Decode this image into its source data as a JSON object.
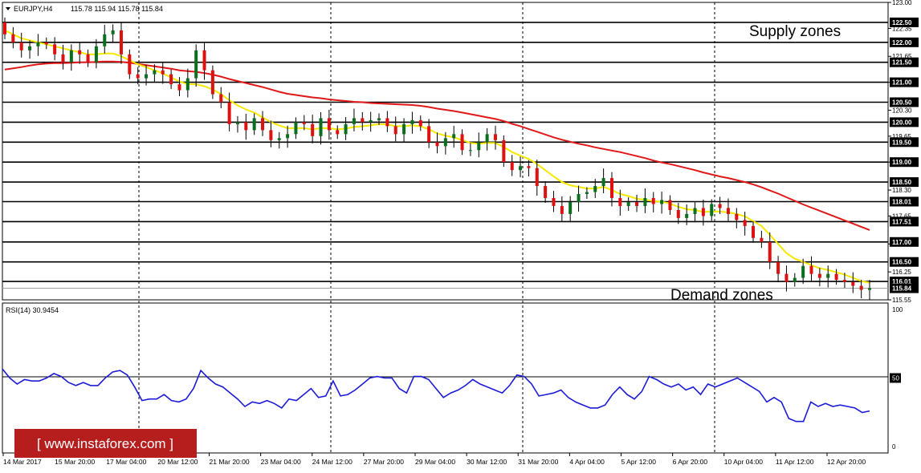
{
  "header": {
    "symbol": "EURJPY,H4",
    "ohlc": "115.78 115.94 115.78 115.84"
  },
  "annotations": {
    "supply": "Supply zones",
    "demand": "Demand zones"
  },
  "watermark": "[ www.instaforex.com ]",
  "rsi": {
    "label": "RSI(14) 30.9454",
    "ticks": [
      "100",
      "50",
      "0"
    ],
    "values": [
      56,
      50,
      46,
      49,
      48,
      48,
      50,
      53,
      51,
      47,
      45,
      47,
      45,
      45,
      50,
      54,
      55,
      52,
      44,
      35,
      36,
      36,
      39,
      35,
      34,
      36,
      43,
      55,
      50,
      46,
      44,
      40,
      36,
      31,
      34,
      33,
      35,
      33,
      30,
      36,
      35,
      39,
      43,
      37,
      38,
      48,
      38,
      39,
      42,
      46,
      50,
      51,
      50,
      50,
      43,
      40,
      51,
      51,
      49,
      43,
      37,
      40,
      42,
      45,
      49,
      46,
      44,
      42,
      40,
      45,
      52,
      51,
      46,
      38,
      39,
      40,
      42,
      37,
      34,
      32,
      30,
      30,
      32,
      39,
      44,
      39,
      36,
      41,
      51,
      49,
      46,
      44,
      46,
      42,
      44,
      39,
      46,
      44,
      46,
      48,
      50,
      47,
      44,
      41,
      34,
      37,
      34,
      23,
      21,
      21,
      34,
      31,
      33,
      31,
      32,
      31,
      30,
      27,
      28
    ]
  },
  "chart_data": {
    "type": "candlestick",
    "title": "EURJPY,H4",
    "ylim": [
      115.55,
      123.0
    ],
    "price_ticks": [
      "123.00",
      "122.35",
      "121.65",
      "121.00",
      "120.30",
      "119.65",
      "119.00",
      "118.30",
      "117.65",
      "116.95",
      "116.25",
      "115.55"
    ],
    "level_lines": [
      122.5,
      122.0,
      121.5,
      121.0,
      120.5,
      120.0,
      119.5,
      119.0,
      118.5,
      118.01,
      117.51,
      117.0,
      116.5,
      116.01,
      115.84
    ],
    "level_labels": [
      "122.50",
      "122.00",
      "121.50",
      "121.00",
      "120.50",
      "120.00",
      "119.50",
      "119.00",
      "118.50",
      "118.01",
      "117.51",
      "117.00",
      "116.50",
      "116.01",
      "115.84"
    ],
    "time_labels": [
      "14 Mar 2017",
      "15 Mar 20:00",
      "17 Mar 04:00",
      "20 Mar 12:00",
      "21 Mar 20:00",
      "23 Mar 04:00",
      "24 Mar 12:00",
      "27 Mar 20:00",
      "29 Mar 04:00",
      "30 Mar 12:00",
      "31 Mar 20:00",
      "4 Apr 04:00",
      "5 Apr 12:00",
      "6 Apr 20:00",
      "10 Apr 04:00",
      "11 Apr 12:00",
      "12 Apr 20:00"
    ],
    "closes": [
      122.2,
      122.0,
      121.8,
      121.9,
      122.0,
      121.95,
      121.7,
      121.5,
      121.8,
      121.7,
      121.5,
      121.9,
      122.2,
      122.3,
      121.7,
      121.2,
      121.1,
      121.2,
      121.3,
      121.2,
      120.95,
      120.8,
      121.1,
      121.8,
      121.3,
      120.7,
      120.5,
      119.95,
      120.0,
      119.8,
      120.1,
      119.8,
      119.55,
      119.6,
      119.7,
      120.0,
      119.95,
      119.65,
      120.1,
      119.8,
      119.7,
      119.95,
      120.1,
      120.0,
      120.05,
      120.1,
      119.9,
      119.7,
      119.95,
      120.05,
      119.9,
      119.5,
      119.4,
      119.6,
      119.7,
      119.3,
      119.3,
      119.5,
      119.7,
      119.55,
      119.0,
      118.8,
      118.9,
      118.85,
      118.4,
      118.1,
      117.9,
      117.7,
      118.0,
      118.2,
      118.25,
      118.4,
      118.6,
      118.1,
      117.9,
      118.0,
      117.9,
      118.1,
      117.95,
      118.05,
      117.8,
      117.6,
      117.7,
      117.85,
      117.65,
      117.95,
      117.85,
      117.7,
      117.55,
      117.4,
      117.1,
      117.0,
      116.5,
      116.2,
      116.0,
      116.1,
      116.4,
      116.2,
      116.1,
      116.2,
      116.05,
      116.0,
      115.9,
      115.8,
      115.84
    ],
    "ma_fast": [
      122.3,
      122.2,
      122.1,
      122.05,
      122.0,
      121.95,
      121.9,
      121.85,
      121.8,
      121.75,
      121.7,
      121.7,
      121.72,
      121.72,
      121.65,
      121.55,
      121.45,
      121.38,
      121.3,
      121.22,
      121.12,
      121.02,
      120.95,
      120.95,
      120.9,
      120.82,
      120.7,
      120.55,
      120.42,
      120.32,
      120.24,
      120.12,
      120.0,
      119.92,
      119.85,
      119.85,
      119.85,
      119.82,
      119.85,
      119.85,
      119.82,
      119.84,
      119.88,
      119.9,
      119.92,
      119.95,
      119.94,
      119.9,
      119.9,
      119.92,
      119.9,
      119.82,
      119.72,
      119.66,
      119.62,
      119.55,
      119.48,
      119.46,
      119.48,
      119.48,
      119.38,
      119.25,
      119.16,
      119.08,
      118.95,
      118.8,
      118.64,
      118.5,
      118.42,
      118.38,
      118.34,
      118.34,
      118.38,
      118.3,
      118.2,
      118.15,
      118.08,
      118.06,
      118.02,
      118.01,
      117.96,
      117.88,
      117.82,
      117.8,
      117.75,
      117.76,
      117.76,
      117.74,
      117.7,
      117.64,
      117.52,
      117.4,
      117.18,
      116.95,
      116.72,
      116.58,
      116.5,
      116.42,
      116.34,
      116.3,
      116.24,
      116.18,
      116.1,
      116.02,
      115.98
    ],
    "ma_slow": [
      121.32,
      121.35,
      121.38,
      121.42,
      121.45,
      121.47,
      121.48,
      121.48,
      121.49,
      121.5,
      121.5,
      121.51,
      121.52,
      121.52,
      121.51,
      121.49,
      121.46,
      121.43,
      121.4,
      121.37,
      121.34,
      121.3,
      121.28,
      121.26,
      121.23,
      121.19,
      121.14,
      121.08,
      121.03,
      120.98,
      120.93,
      120.88,
      120.82,
      120.76,
      120.71,
      120.68,
      120.65,
      120.62,
      120.6,
      120.57,
      120.55,
      120.53,
      120.51,
      120.5,
      120.48,
      120.47,
      120.46,
      120.45,
      120.44,
      120.43,
      120.41,
      120.38,
      120.34,
      120.31,
      120.28,
      120.24,
      120.2,
      120.16,
      120.12,
      120.08,
      120.03,
      119.96,
      119.9,
      119.83,
      119.76,
      119.69,
      119.62,
      119.56,
      119.51,
      119.46,
      119.42,
      119.37,
      119.33,
      119.29,
      119.25,
      119.2,
      119.15,
      119.1,
      119.04,
      118.99,
      118.95,
      118.9,
      118.85,
      118.8,
      118.74,
      118.69,
      118.64,
      118.6,
      118.55,
      118.5,
      118.44,
      118.37,
      118.29,
      118.21,
      118.12,
      118.03,
      117.94,
      117.86,
      117.78,
      117.7,
      117.62,
      117.54,
      117.46,
      117.38,
      117.3
    ]
  }
}
